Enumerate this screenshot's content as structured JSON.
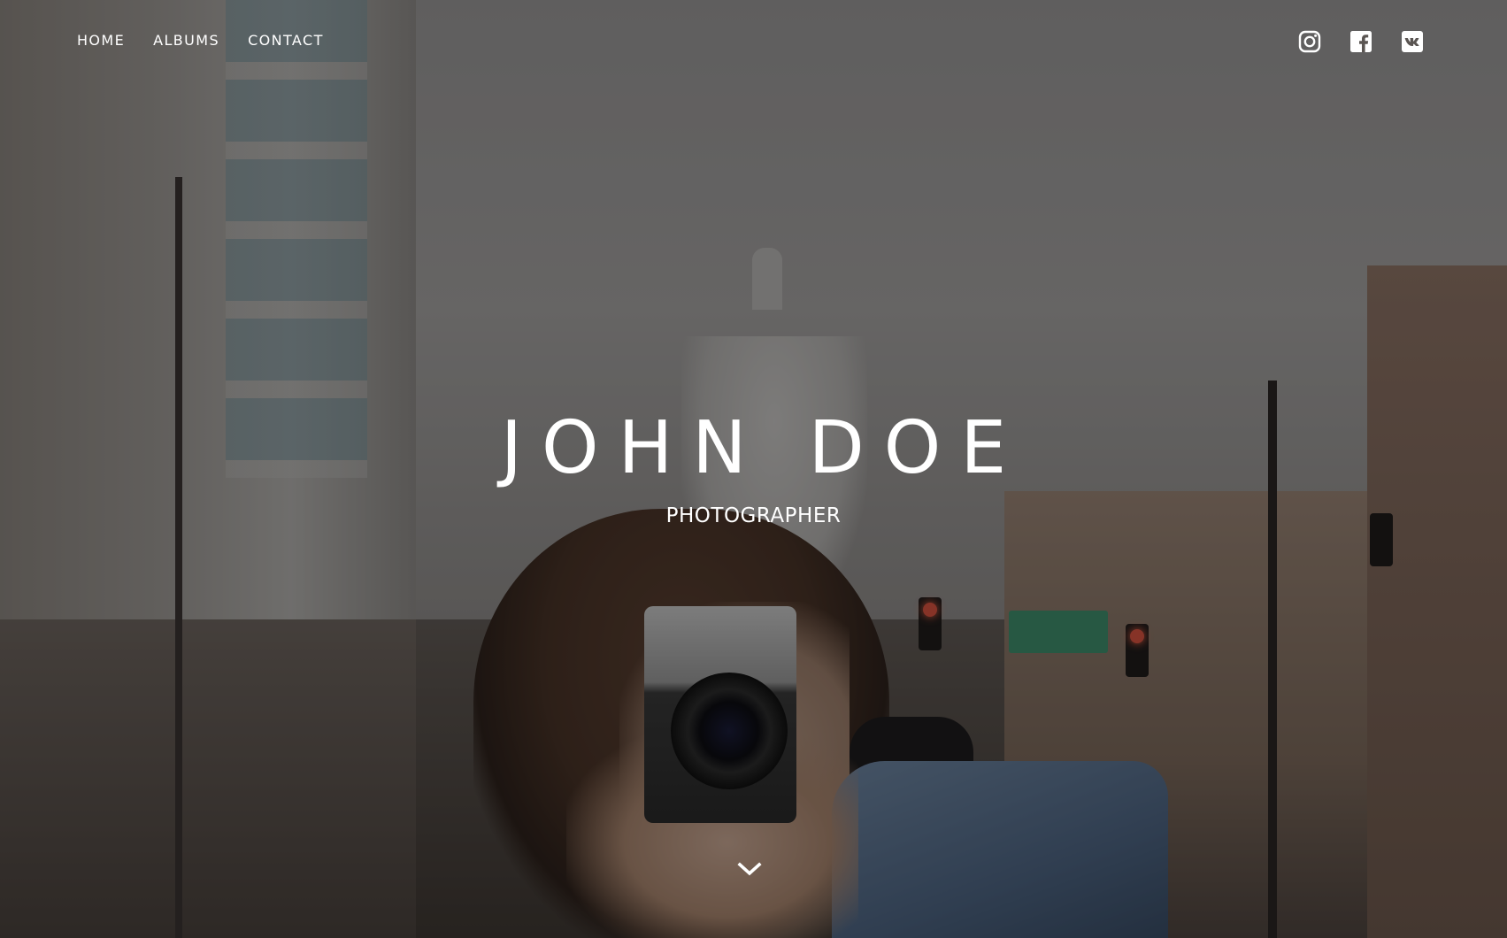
{
  "nav": {
    "items": [
      {
        "label": "HOME"
      },
      {
        "label": "ALBUMS"
      },
      {
        "label": "CONTACT"
      }
    ]
  },
  "social": {
    "icons": [
      "instagram-icon",
      "facebook-icon",
      "vk-icon"
    ]
  },
  "hero": {
    "title": "JOHN DOE",
    "subtitle": "PHOTOGRAPHER",
    "scroll_icon": "chevron-down-icon"
  },
  "colors": {
    "text": "#ffffff",
    "overlay": "rgba(0,0,0,0.38)"
  }
}
